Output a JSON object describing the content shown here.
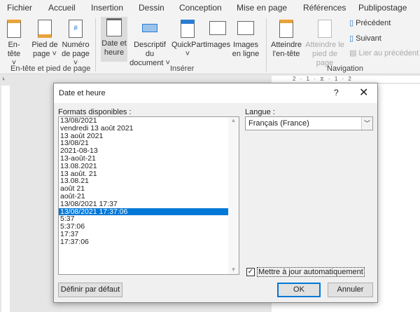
{
  "tabs": [
    "Fichier",
    "Accueil",
    "Insertion",
    "Dessin",
    "Conception",
    "Mise en page",
    "Références",
    "Publipostage"
  ],
  "ribbon": {
    "header_footer": {
      "group": "En-tête et pied de page",
      "entete": [
        "En-",
        "tête ˅"
      ],
      "pied": [
        "Pied de",
        "page ˅"
      ],
      "numero": [
        "Numéro",
        "de page ˅"
      ]
    },
    "inserer": {
      "group": "Insérer",
      "date": [
        "Date et",
        "heure"
      ],
      "descriptif": [
        "Descriptif du",
        "document ˅"
      ],
      "quickpart": [
        "QuickPart",
        "˅"
      ],
      "images": "Images",
      "images_ligne": [
        "Images",
        "en ligne"
      ]
    },
    "navigation": {
      "group": "Navigation",
      "atteindre_entete": [
        "Atteindre",
        "l'en-tête"
      ],
      "atteindre_pied": [
        "Atteindre le",
        "pied de page"
      ],
      "precedent": "Précédent",
      "suivant": "Suivant",
      "lier": "Lier au précédent"
    }
  },
  "ruler": {
    "text": "2 · 1 · ⧖ · 1 · 2"
  },
  "dialog": {
    "title": "Date et heure",
    "help": "?",
    "close": "✕",
    "formats_label": "Formats disponibles :",
    "formats": [
      "13/08/2021",
      "vendredi 13 août 2021",
      "13 août 2021",
      "13/08/21",
      "2021-08-13",
      "13-août-21",
      "13.08.2021",
      "13 août. 21",
      "13.08.21",
      "août 21",
      "août-21",
      "13/08/2021 17:37",
      "13/08/2021 17:37:06",
      "5:37",
      "5:37:06",
      "17:37",
      "17:37:06"
    ],
    "selected_index": 12,
    "langue_label": "Langue :",
    "langue_value": "Français (France)",
    "auto_update_label": "Mettre à jour automatiquement",
    "auto_update_checked": true,
    "default_button": "Définir par défaut",
    "ok_button": "OK",
    "cancel_button": "Annuler"
  }
}
